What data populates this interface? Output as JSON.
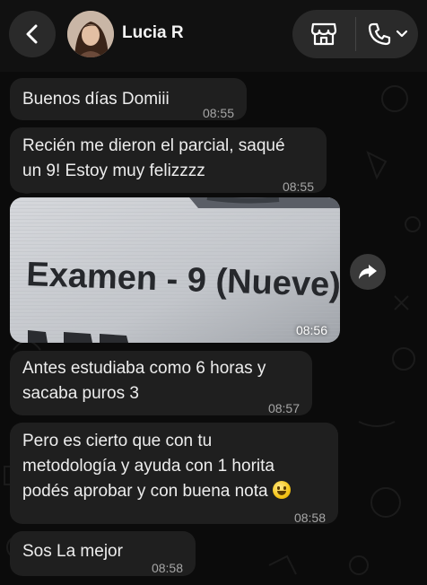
{
  "header": {
    "back_icon": "chevron-left-icon",
    "contact_name": "Lucia R",
    "store_icon": "storefront-icon",
    "call_icon": "phone-icon",
    "dropdown_icon": "chevron-down-icon"
  },
  "messages": [
    {
      "text_lines": [
        "Buenos días Domiii"
      ],
      "time": "08:55"
    },
    {
      "text_lines": [
        "Recién me dieron el parcial, saqué",
        "un 9! Estoy muy felizzzz"
      ],
      "time": "08:55"
    },
    {
      "type": "image",
      "image_text": "Examen - 9 (Nueve)",
      "time": "08:56",
      "forward_icon": "forward-icon"
    },
    {
      "text_lines": [
        "Antes estudiaba como 6 horas y",
        "sacaba puros 3"
      ],
      "time": "08:57"
    },
    {
      "text_lines": [
        "Pero es cierto que con tu",
        "metodología y ayuda con 1 horita",
        "podés aprobar y con buena nota"
      ],
      "emoji": "grinning-face",
      "time": "08:58"
    },
    {
      "text_lines": [
        "Sos La mejor"
      ],
      "time": "08:58"
    }
  ],
  "colors": {
    "background": "#0b0b0b",
    "bubble": "#1f1f1f",
    "header_button": "#2a2a2a",
    "text": "#ededed",
    "timestamp": "#a6a6a6"
  }
}
